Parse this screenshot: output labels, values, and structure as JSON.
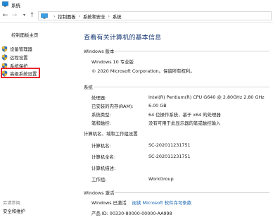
{
  "window": {
    "title": "系统"
  },
  "address_bar": {
    "crumbs": [
      "控制面板",
      "系统和安全",
      "系统"
    ]
  },
  "sidebar": {
    "home_label": "控制面板主页",
    "items": [
      {
        "label": "设备管理器",
        "icon": "shield-icon"
      },
      {
        "label": "远程设置",
        "icon": "shield-icon"
      },
      {
        "label": "系统保护",
        "icon": "shield-icon"
      },
      {
        "label": "高级系统设置",
        "icon": "shield-icon",
        "highlighted": true
      }
    ],
    "see_also_label": "另请参阅",
    "see_also_items": [
      "安全和维护"
    ],
    "highlight_color": "#e8262a"
  },
  "main": {
    "title": "查看有关计算机的基本信息",
    "windows_edition": {
      "header": "Windows 版本",
      "edition": "Windows 10 专业版",
      "copyright": "© 2020 Microsoft Corporation。保留所有权利。"
    },
    "system": {
      "header": "系统",
      "rows": [
        {
          "label": "处理器:",
          "value": "Intel(R) Pentium(R) CPU G640 @ 2.80GHz   2.80 GHz"
        },
        {
          "label": "已安装的内存(RAM):",
          "value": "6.00 GB"
        },
        {
          "label": "系统类型:",
          "value": "64 位操作系统，基于 x64 的处理器"
        },
        {
          "label": "笔和触控:",
          "value": "没有可用于此显示器的笔或触控输入"
        }
      ]
    },
    "computer_name": {
      "header": "计算机名、域和工作组设置",
      "rows": [
        {
          "label": "计算机名:",
          "value": "SC-202011231751"
        },
        {
          "label": "计算机全名:",
          "value": "SC-202011231751"
        },
        {
          "label": "计算机描述:",
          "value": ""
        },
        {
          "label": "工作组:",
          "value": "WorkGroup"
        }
      ]
    },
    "activation": {
      "header": "Windows 激活",
      "status": "Windows 已激活",
      "license_link": "阅读 Microsoft 软件许可条款",
      "product_id": "产品 ID: 00330-80000-00000-AA998"
    }
  },
  "colors": {
    "title_blue": "#1f3f7a",
    "link_blue": "#0b5cad"
  }
}
